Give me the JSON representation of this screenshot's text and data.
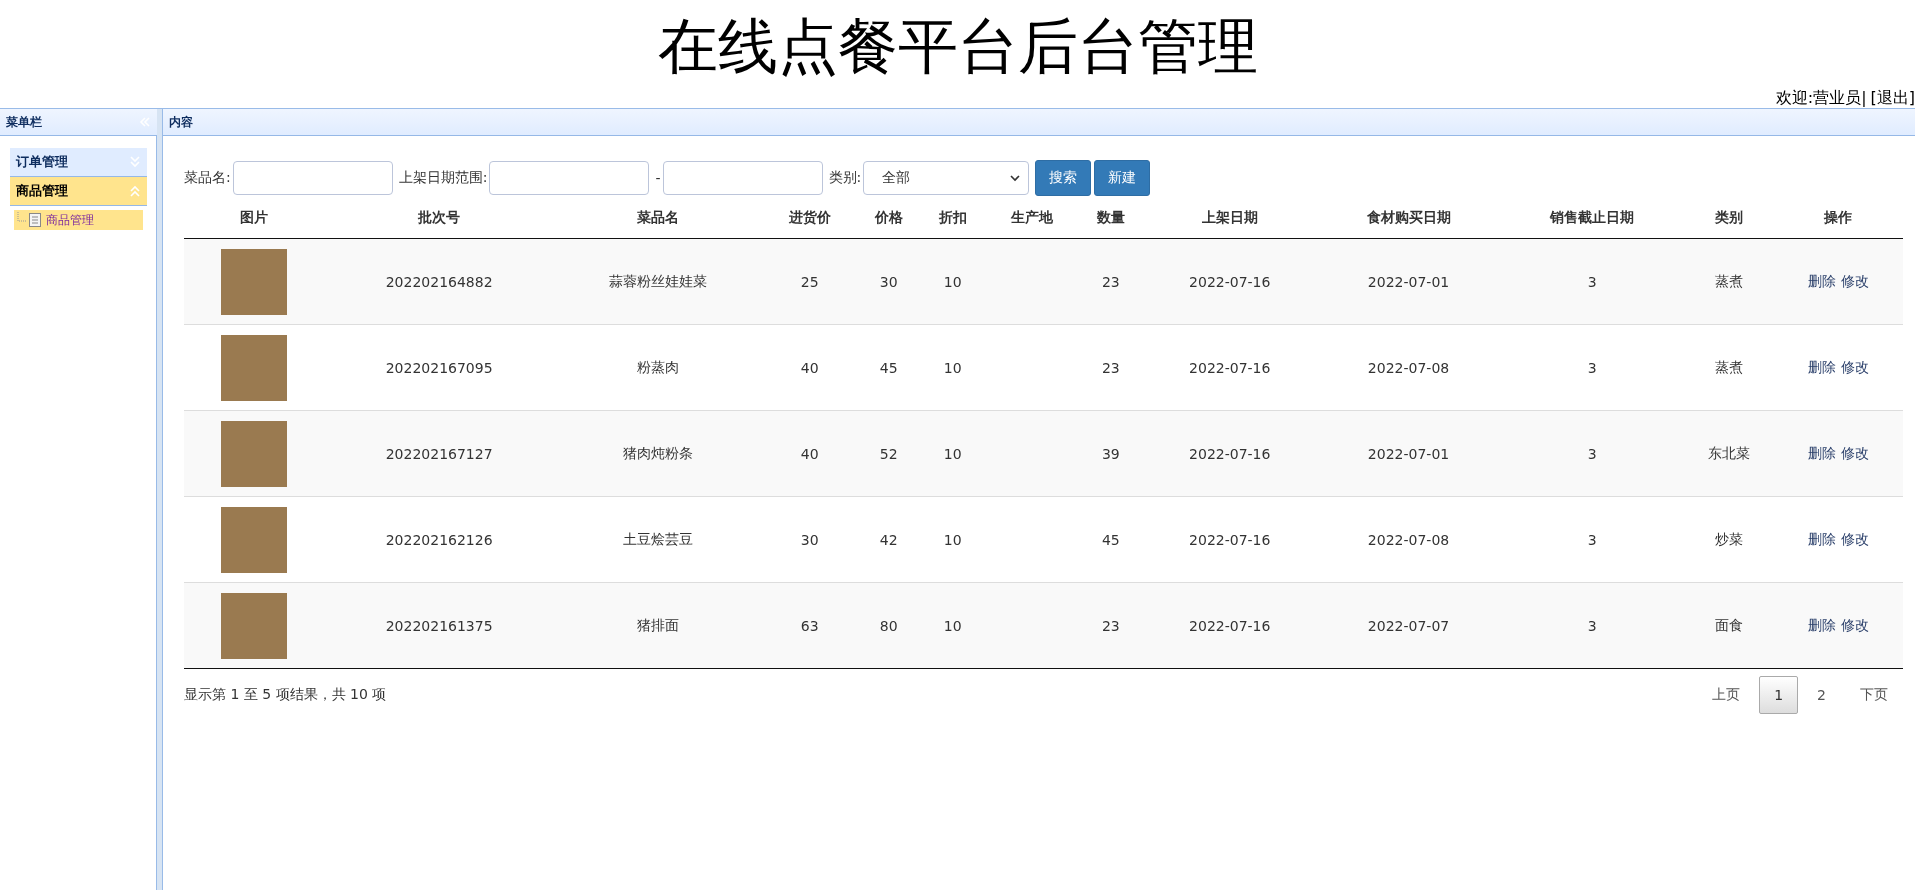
{
  "header": {
    "title": "在线点餐平台后台管理",
    "welcome": "欢迎:营业员|",
    "logout": "[退出]"
  },
  "sidebar": {
    "title": "菜单栏",
    "groups": [
      {
        "label": "订单管理",
        "expanded": false
      },
      {
        "label": "商品管理",
        "expanded": true,
        "children": [
          {
            "label": "商品管理",
            "selected": true
          }
        ]
      }
    ]
  },
  "content": {
    "title": "内容",
    "search": {
      "name_label": "菜品名:",
      "date_label": "上架日期范围:",
      "dash": "-",
      "category_label": "类别:",
      "category_value": "全部",
      "search_button": "搜索",
      "new_button": "新建"
    },
    "table": {
      "columns": [
        "图片",
        "批次号",
        "菜品名",
        "进货价",
        "价格",
        "折扣",
        "生产地",
        "数量",
        "上架日期",
        "食材购买日期",
        "销售截止日期",
        "类别",
        "操作"
      ],
      "rows": [
        {
          "batch": "202202164882",
          "name": "蒜蓉粉丝娃娃菜",
          "cost": "25",
          "price": "30",
          "discount": "10",
          "origin": "",
          "qty": "23",
          "listed": "2022-07-16",
          "bought": "2022-07-01",
          "deadline": "3",
          "category": "蒸煮",
          "delete": "删除",
          "edit": "修改"
        },
        {
          "batch": "202202167095",
          "name": "粉蒸肉",
          "cost": "40",
          "price": "45",
          "discount": "10",
          "origin": "",
          "qty": "23",
          "listed": "2022-07-16",
          "bought": "2022-07-08",
          "deadline": "3",
          "category": "蒸煮",
          "delete": "删除",
          "edit": "修改"
        },
        {
          "batch": "202202167127",
          "name": "猪肉炖粉条",
          "cost": "40",
          "price": "52",
          "discount": "10",
          "origin": "",
          "qty": "39",
          "listed": "2022-07-16",
          "bought": "2022-07-01",
          "deadline": "3",
          "category": "东北菜",
          "delete": "删除",
          "edit": "修改"
        },
        {
          "batch": "202202162126",
          "name": "土豆烩芸豆",
          "cost": "30",
          "price": "42",
          "discount": "10",
          "origin": "",
          "qty": "45",
          "listed": "2022-07-16",
          "bought": "2022-07-08",
          "deadline": "3",
          "category": "炒菜",
          "delete": "删除",
          "edit": "修改"
        },
        {
          "batch": "202202161375",
          "name": "猪排面",
          "cost": "63",
          "price": "80",
          "discount": "10",
          "origin": "",
          "qty": "23",
          "listed": "2022-07-16",
          "bought": "2022-07-07",
          "deadline": "3",
          "category": "面食",
          "delete": "删除",
          "edit": "修改"
        }
      ]
    },
    "summary": "显示第 1 至 5 项结果，共 10 项",
    "pagination": {
      "prev": "上页",
      "next": "下页",
      "pages": [
        {
          "label": "1",
          "selected": true
        },
        {
          "label": "2",
          "selected": false
        }
      ]
    }
  }
}
